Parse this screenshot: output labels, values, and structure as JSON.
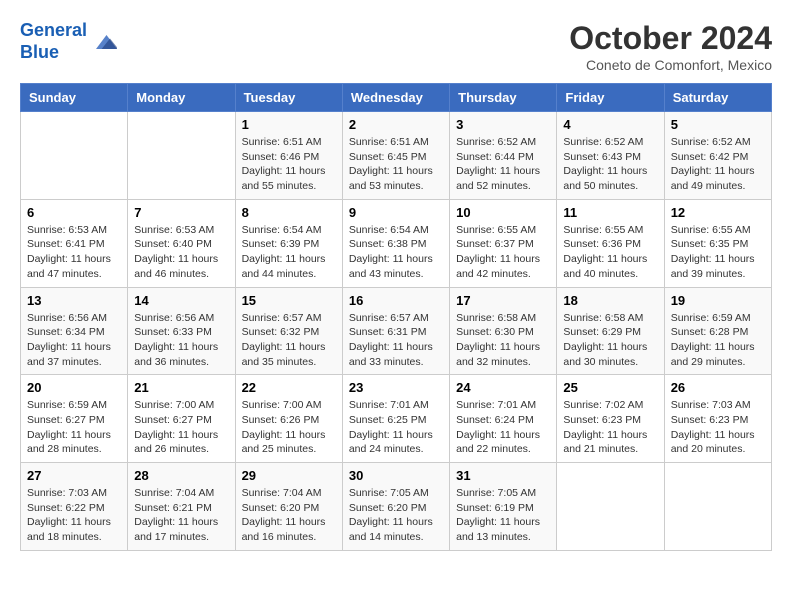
{
  "header": {
    "logo_line1": "General",
    "logo_line2": "Blue",
    "month": "October 2024",
    "location": "Coneto de Comonfort, Mexico"
  },
  "columns": [
    "Sunday",
    "Monday",
    "Tuesday",
    "Wednesday",
    "Thursday",
    "Friday",
    "Saturday"
  ],
  "weeks": [
    [
      {
        "day": "",
        "info": ""
      },
      {
        "day": "",
        "info": ""
      },
      {
        "day": "1",
        "info": "Sunrise: 6:51 AM\nSunset: 6:46 PM\nDaylight: 11 hours and 55 minutes."
      },
      {
        "day": "2",
        "info": "Sunrise: 6:51 AM\nSunset: 6:45 PM\nDaylight: 11 hours and 53 minutes."
      },
      {
        "day": "3",
        "info": "Sunrise: 6:52 AM\nSunset: 6:44 PM\nDaylight: 11 hours and 52 minutes."
      },
      {
        "day": "4",
        "info": "Sunrise: 6:52 AM\nSunset: 6:43 PM\nDaylight: 11 hours and 50 minutes."
      },
      {
        "day": "5",
        "info": "Sunrise: 6:52 AM\nSunset: 6:42 PM\nDaylight: 11 hours and 49 minutes."
      }
    ],
    [
      {
        "day": "6",
        "info": "Sunrise: 6:53 AM\nSunset: 6:41 PM\nDaylight: 11 hours and 47 minutes."
      },
      {
        "day": "7",
        "info": "Sunrise: 6:53 AM\nSunset: 6:40 PM\nDaylight: 11 hours and 46 minutes."
      },
      {
        "day": "8",
        "info": "Sunrise: 6:54 AM\nSunset: 6:39 PM\nDaylight: 11 hours and 44 minutes."
      },
      {
        "day": "9",
        "info": "Sunrise: 6:54 AM\nSunset: 6:38 PM\nDaylight: 11 hours and 43 minutes."
      },
      {
        "day": "10",
        "info": "Sunrise: 6:55 AM\nSunset: 6:37 PM\nDaylight: 11 hours and 42 minutes."
      },
      {
        "day": "11",
        "info": "Sunrise: 6:55 AM\nSunset: 6:36 PM\nDaylight: 11 hours and 40 minutes."
      },
      {
        "day": "12",
        "info": "Sunrise: 6:55 AM\nSunset: 6:35 PM\nDaylight: 11 hours and 39 minutes."
      }
    ],
    [
      {
        "day": "13",
        "info": "Sunrise: 6:56 AM\nSunset: 6:34 PM\nDaylight: 11 hours and 37 minutes."
      },
      {
        "day": "14",
        "info": "Sunrise: 6:56 AM\nSunset: 6:33 PM\nDaylight: 11 hours and 36 minutes."
      },
      {
        "day": "15",
        "info": "Sunrise: 6:57 AM\nSunset: 6:32 PM\nDaylight: 11 hours and 35 minutes."
      },
      {
        "day": "16",
        "info": "Sunrise: 6:57 AM\nSunset: 6:31 PM\nDaylight: 11 hours and 33 minutes."
      },
      {
        "day": "17",
        "info": "Sunrise: 6:58 AM\nSunset: 6:30 PM\nDaylight: 11 hours and 32 minutes."
      },
      {
        "day": "18",
        "info": "Sunrise: 6:58 AM\nSunset: 6:29 PM\nDaylight: 11 hours and 30 minutes."
      },
      {
        "day": "19",
        "info": "Sunrise: 6:59 AM\nSunset: 6:28 PM\nDaylight: 11 hours and 29 minutes."
      }
    ],
    [
      {
        "day": "20",
        "info": "Sunrise: 6:59 AM\nSunset: 6:27 PM\nDaylight: 11 hours and 28 minutes."
      },
      {
        "day": "21",
        "info": "Sunrise: 7:00 AM\nSunset: 6:27 PM\nDaylight: 11 hours and 26 minutes."
      },
      {
        "day": "22",
        "info": "Sunrise: 7:00 AM\nSunset: 6:26 PM\nDaylight: 11 hours and 25 minutes."
      },
      {
        "day": "23",
        "info": "Sunrise: 7:01 AM\nSunset: 6:25 PM\nDaylight: 11 hours and 24 minutes."
      },
      {
        "day": "24",
        "info": "Sunrise: 7:01 AM\nSunset: 6:24 PM\nDaylight: 11 hours and 22 minutes."
      },
      {
        "day": "25",
        "info": "Sunrise: 7:02 AM\nSunset: 6:23 PM\nDaylight: 11 hours and 21 minutes."
      },
      {
        "day": "26",
        "info": "Sunrise: 7:03 AM\nSunset: 6:23 PM\nDaylight: 11 hours and 20 minutes."
      }
    ],
    [
      {
        "day": "27",
        "info": "Sunrise: 7:03 AM\nSunset: 6:22 PM\nDaylight: 11 hours and 18 minutes."
      },
      {
        "day": "28",
        "info": "Sunrise: 7:04 AM\nSunset: 6:21 PM\nDaylight: 11 hours and 17 minutes."
      },
      {
        "day": "29",
        "info": "Sunrise: 7:04 AM\nSunset: 6:20 PM\nDaylight: 11 hours and 16 minutes."
      },
      {
        "day": "30",
        "info": "Sunrise: 7:05 AM\nSunset: 6:20 PM\nDaylight: 11 hours and 14 minutes."
      },
      {
        "day": "31",
        "info": "Sunrise: 7:05 AM\nSunset: 6:19 PM\nDaylight: 11 hours and 13 minutes."
      },
      {
        "day": "",
        "info": ""
      },
      {
        "day": "",
        "info": ""
      }
    ]
  ]
}
